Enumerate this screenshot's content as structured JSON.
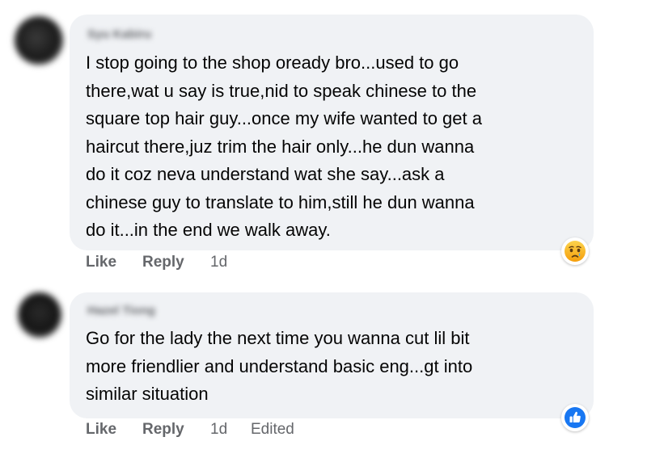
{
  "comments": [
    {
      "author": "Syu Kabiru",
      "text_lines": [
        "I stop going to the shop oready bro...used to go",
        "there,wat u say is true,nid to speak chinese to the",
        "square top hair guy...once my wife wanted to get a",
        "haircut there,juz trim the hair only...he dun wanna",
        "do it coz neva understand wat she say...ask a",
        "chinese guy to translate to him,still he dun wanna",
        "do it...in the end we walk away."
      ],
      "like_label": "Like",
      "reply_label": "Reply",
      "time": "1d",
      "reaction_icon": "sad-reaction-icon"
    },
    {
      "author": "Hazel Tiong",
      "text_lines": [
        "Go for the lady the next time you wanna cut lil bit",
        "more friendlier and understand basic eng...gt into",
        "similar situation"
      ],
      "like_label": "Like",
      "reply_label": "Reply",
      "time": "1d",
      "edited_label": "Edited",
      "reaction_icon": "like-reaction-icon"
    }
  ],
  "colors": {
    "bubble": "#f0f2f5",
    "text": "#050505",
    "meta": "#65676b",
    "like_blue": "#1877f2",
    "sad_yellow": "#f7b125"
  }
}
